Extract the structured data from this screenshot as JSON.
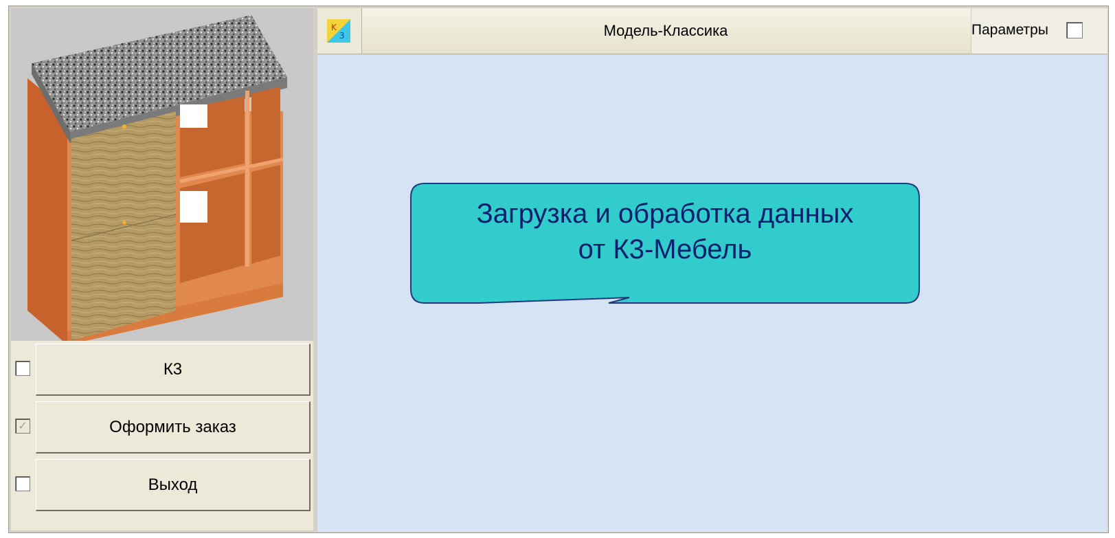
{
  "window": {
    "title": "Модель-Классика",
    "params_label": "Параметры",
    "params_checked": false
  },
  "sidebar": {
    "buttons": [
      {
        "label": "К3",
        "checked": false,
        "disabled": false
      },
      {
        "label": "Оформить заказ",
        "checked": true,
        "disabled": true
      },
      {
        "label": "Выход",
        "checked": false,
        "disabled": false
      }
    ]
  },
  "callout": {
    "line1": "Загрузка и обработка данных",
    "line2": "от К3-Мебель"
  },
  "colors": {
    "canvas_bg": "#d6e3f5",
    "callout_fill": "#33cccc",
    "callout_text": "#0a1f6e",
    "panel_bg": "#ece9d8"
  },
  "icons": {
    "app": "app-logo-icon",
    "preview": "kitchen-cabinet-render"
  }
}
